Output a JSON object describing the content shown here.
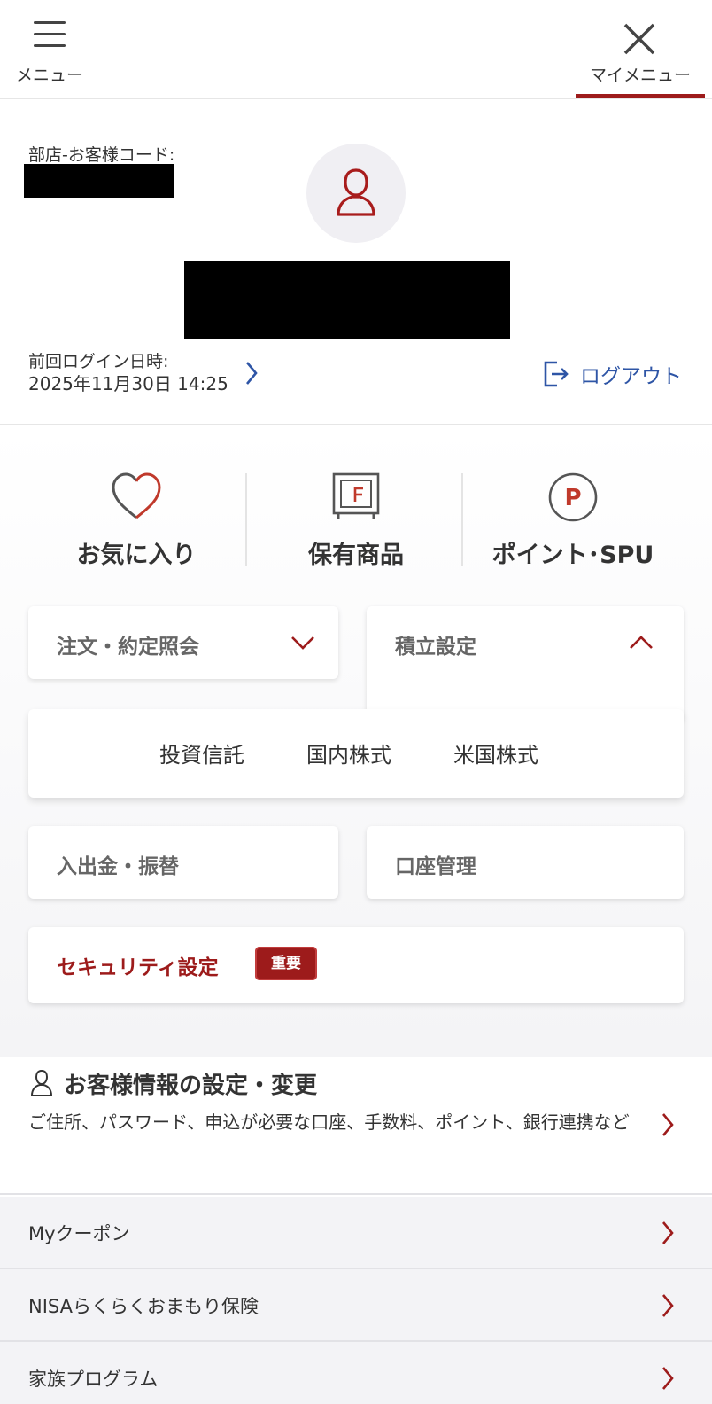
{
  "header": {
    "menu_label": "メニュー",
    "mymenu_label": "マイメニュー"
  },
  "profile": {
    "branch_code_label": "部店-お客様コード:",
    "last_login_label": "前回ログイン日時:",
    "last_login_value": "2025年11月30日 14:25",
    "logout_label": "ログアウト"
  },
  "shortcuts": [
    {
      "label": "お気に入り",
      "icon": "heart-icon"
    },
    {
      "label": "保有商品",
      "icon": "safe-icon"
    },
    {
      "label": "ポイント･SPU",
      "icon": "point-icon"
    }
  ],
  "cards": {
    "order": "注文・約定照会",
    "tsumitate": "積立設定",
    "deposit": "入出金・振替",
    "account": "口座管理",
    "security": "セキュリティ設定",
    "security_badge": "重要"
  },
  "tsumitate_submenu": [
    "投資信託",
    "国内株式",
    "米国株式"
  ],
  "customer_info": {
    "title": "お客様情報の設定・変更",
    "description": "ご住所、パスワード、申込が必要な口座、手数料、ポイント、銀行連携など"
  },
  "list": [
    "Myクーポン",
    "NISAらくらくおまもり保険",
    "家族プログラム"
  ],
  "colors": {
    "accent": "#9d1b1b",
    "link": "#2e55a6",
    "text": "#333333"
  }
}
